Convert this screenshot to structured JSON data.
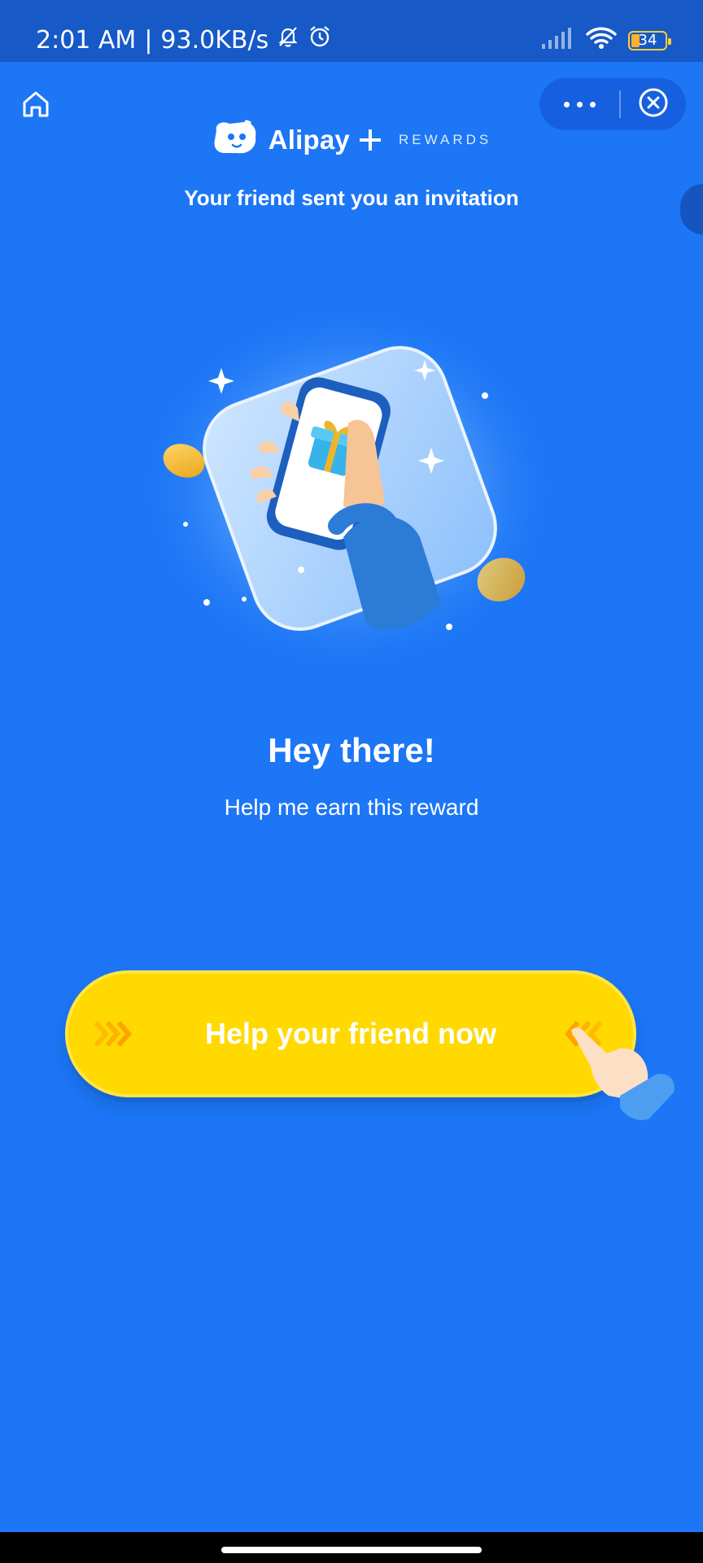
{
  "status_bar": {
    "time": "2:01 AM",
    "separator": "|",
    "speed": "93.0KB/s",
    "icons": [
      "notifications-off-icon",
      "alarm-icon",
      "signal-icon",
      "wifi-icon"
    ],
    "battery": "34"
  },
  "header": {
    "home_icon": "home-icon",
    "more_icon": "more-icon",
    "close_icon": "close-circle-icon",
    "brand_name": "Alipay",
    "brand_sub": "REWARDS",
    "invitation_text": "Your friend sent you an invitation"
  },
  "main": {
    "title": "Hey there!",
    "subtitle": "Help me earn this reward",
    "cta_label": "Help your friend now"
  },
  "colors": {
    "background": "#1c76f6",
    "status_bar": "#1659c7",
    "cta": "#ffd900",
    "arrows": "#ffa200"
  }
}
